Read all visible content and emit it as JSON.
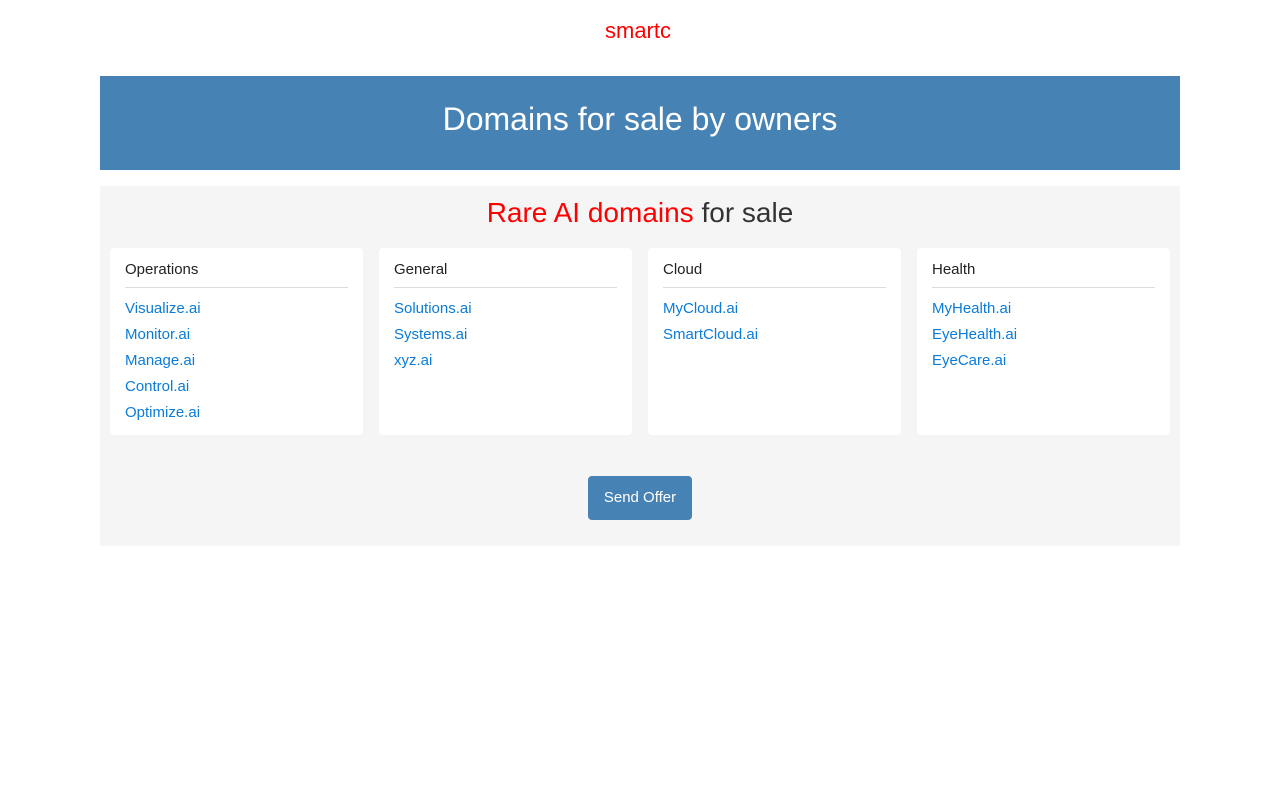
{
  "brand": {
    "text": "smartc"
  },
  "hero": {
    "title": "Domains for sale by owners"
  },
  "panel": {
    "title_accent": "Rare AI domains",
    "title_rest": "for sale",
    "categories": [
      {
        "title": "Operations",
        "domains": [
          "Visualize.ai",
          "Monitor.ai",
          "Manage.ai",
          "Control.ai",
          "Optimize.ai"
        ]
      },
      {
        "title": "General",
        "domains": [
          "Solutions.ai",
          "Systems.ai",
          "xyz.ai"
        ]
      },
      {
        "title": "Cloud",
        "domains": [
          "MyCloud.ai",
          "SmartCloud.ai"
        ]
      },
      {
        "title": "Health",
        "domains": [
          "MyHealth.ai",
          "EyeHealth.ai",
          "EyeCare.ai"
        ]
      }
    ],
    "send_button": "Send Offer"
  },
  "colors": {
    "brand": "#ff0000",
    "hero_bg": "#4682b4",
    "panel_bg": "#f5f5f5",
    "link": "#0a7bd9",
    "button_bg": "#4682b4"
  }
}
